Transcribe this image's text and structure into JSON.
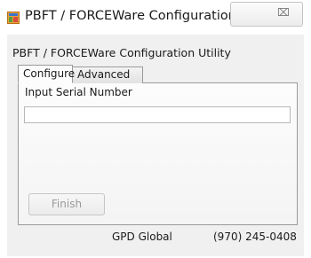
{
  "window": {
    "title": "PBFT / FORCEWare Configuration Utility",
    "close_glyph": "⌧",
    "app_icon": "application-icon"
  },
  "header": {
    "heading": "PBFT / FORCEWare Configuration Utility"
  },
  "tabs": [
    {
      "label": "Configure",
      "selected": true
    },
    {
      "label": "Advanced",
      "selected": false
    }
  ],
  "configure_panel": {
    "serial_label": "Input Serial Number",
    "serial_value": "",
    "finish_label": "Finish",
    "finish_enabled": false
  },
  "footer": {
    "company": "GPD Global",
    "phone": "(970) 245-0408"
  }
}
